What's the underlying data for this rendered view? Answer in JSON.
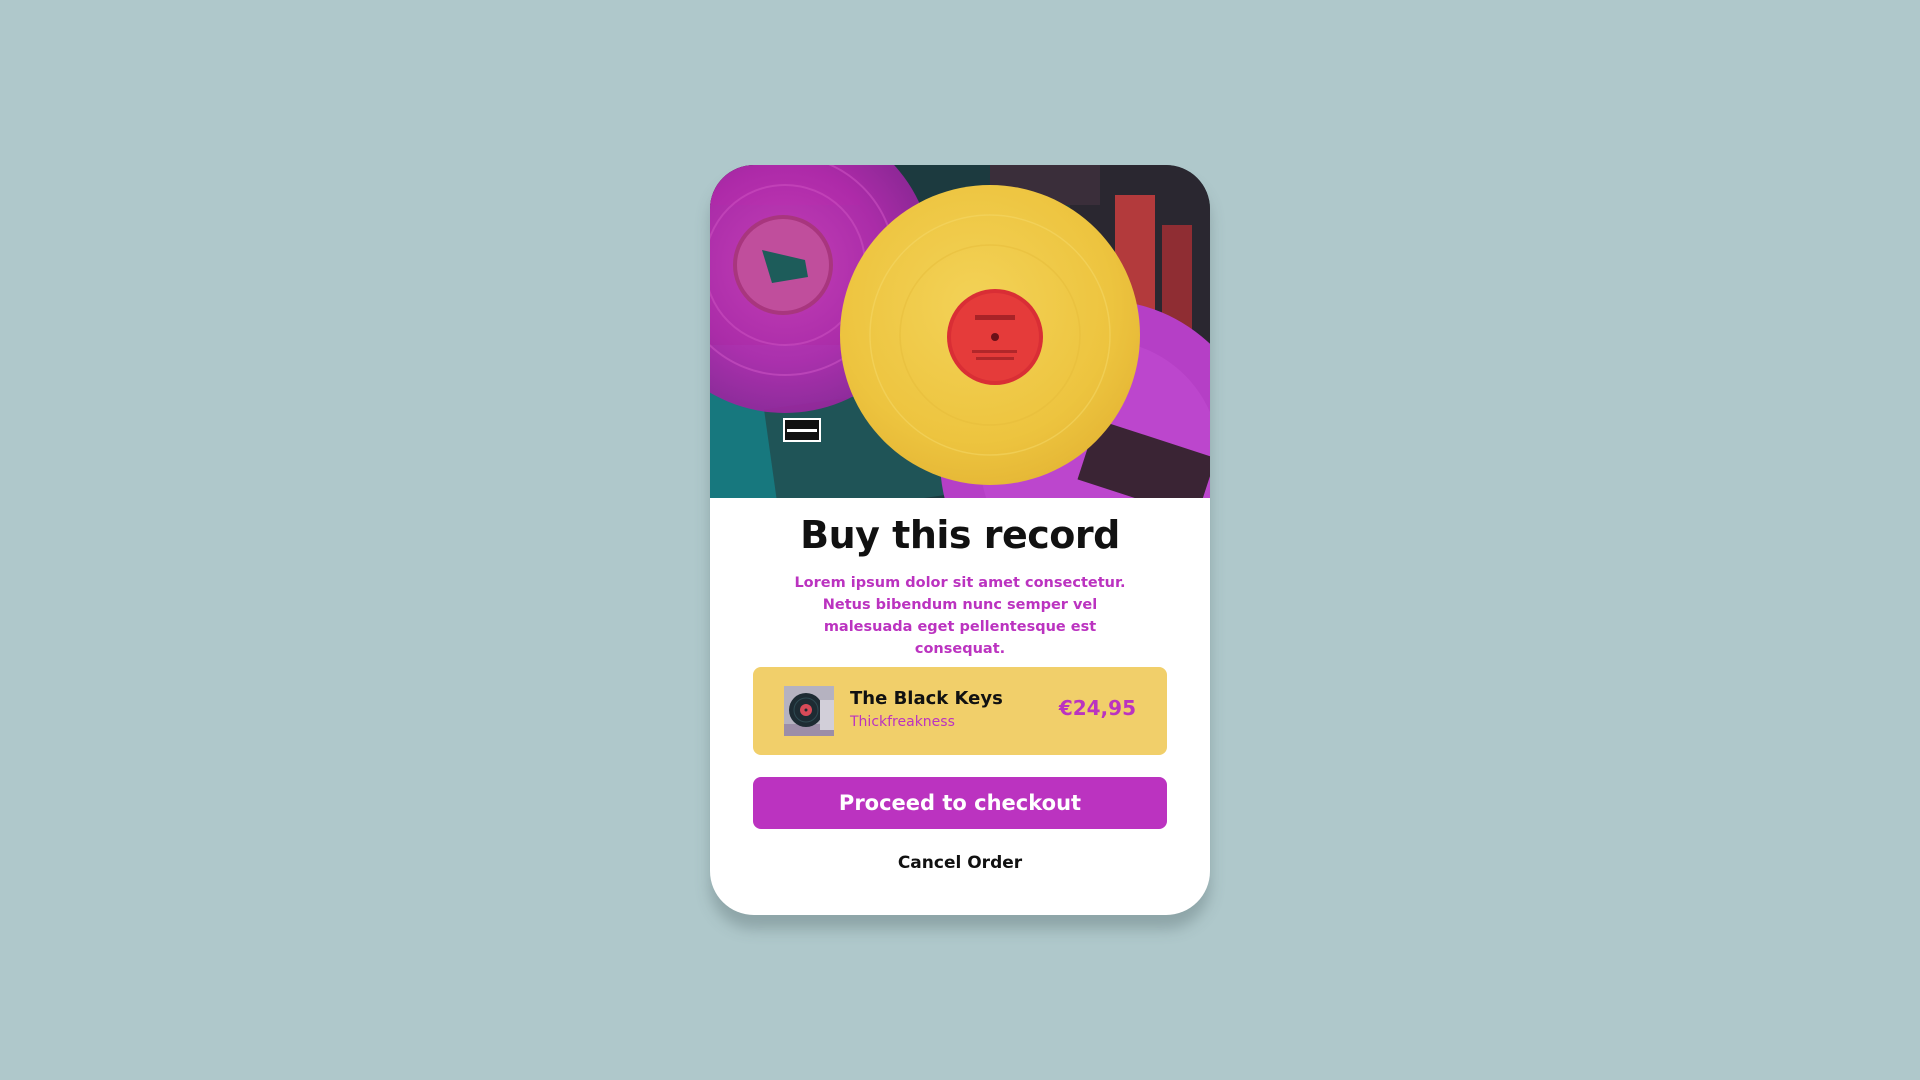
{
  "card": {
    "title": "Buy this record",
    "description": "Lorem ipsum dolor sit amet consectetur. Netus bibendum nunc semper vel malesuada eget pellentesque est consequat.",
    "hero_image": "vinyl-records-photo"
  },
  "order_item": {
    "artist": "The Black Keys",
    "album": "Thickfreakness",
    "price": "€24,95",
    "thumbnail": "album-thumbnail"
  },
  "actions": {
    "checkout_label": "Proceed to checkout",
    "cancel_label": "Cancel Order"
  },
  "colors": {
    "background": "#afc8cb",
    "accent": "#bb33c0",
    "item_box": "#f1cf6a",
    "card": "#ffffff"
  }
}
